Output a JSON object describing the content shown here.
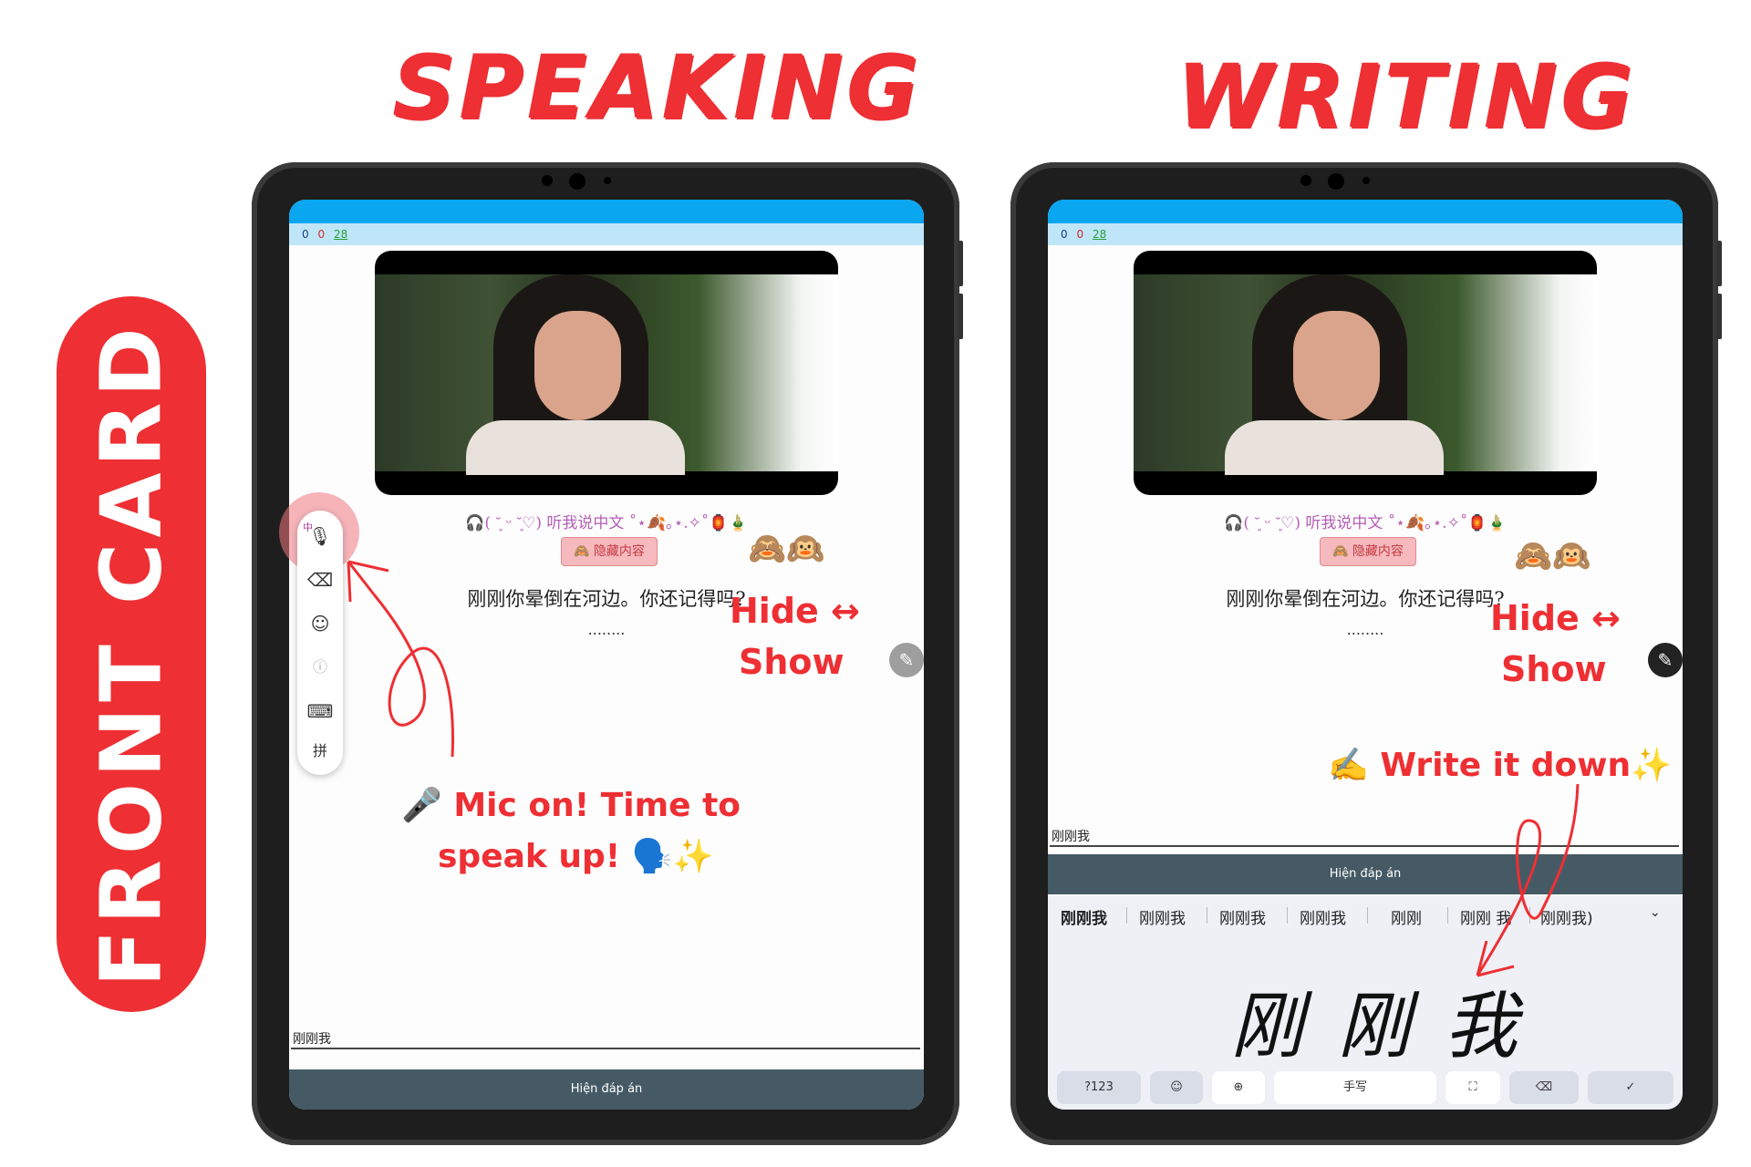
{
  "headings": {
    "speaking": "SPEAKING",
    "writing": "WRITING",
    "front_card": "FRONT CARD"
  },
  "counters": {
    "new": "0",
    "learn": "0",
    "review": "28"
  },
  "card": {
    "subtitle": "🎧( ˘͈ ᵕ ˘͈♡) 听我说中文 ˚⋆🍂｡⋆.✧˚🏮🎍",
    "hide_button": "🙈 隐藏内容",
    "sentence": "刚刚你晕倒在河边。你还记得吗?",
    "dots": "........"
  },
  "left": {
    "answer_text": "刚刚我",
    "reveal_label": "Hiện đáp án",
    "toolbar": {
      "ime": "中",
      "pinyin": "拼"
    }
  },
  "right": {
    "answer_text": "刚刚我",
    "reveal_label": "Hiện đáp án",
    "candidates": [
      "刚刚我",
      "刚刚我",
      "刚刚我",
      "刚刚我",
      "刚刚",
      "刚刚 我",
      "刚刚我)"
    ],
    "handwriting": "刚 刚 我",
    "keys": {
      "numbers": "?123",
      "handwrite": "手写"
    }
  },
  "annotations": {
    "monkeys": "🙈🙉",
    "hide_show_1": "Hide ↔",
    "hide_show_2": "Show",
    "mic_line1": "🎤 Mic on! Time to",
    "mic_line2": "speak up! 🗣️✨",
    "write_it_down": "✍️ Write it down✨"
  },
  "colors": {
    "accent_red": "#ee2f33",
    "status_blue": "#0aa6ef",
    "reveal_bar": "#455a64"
  }
}
